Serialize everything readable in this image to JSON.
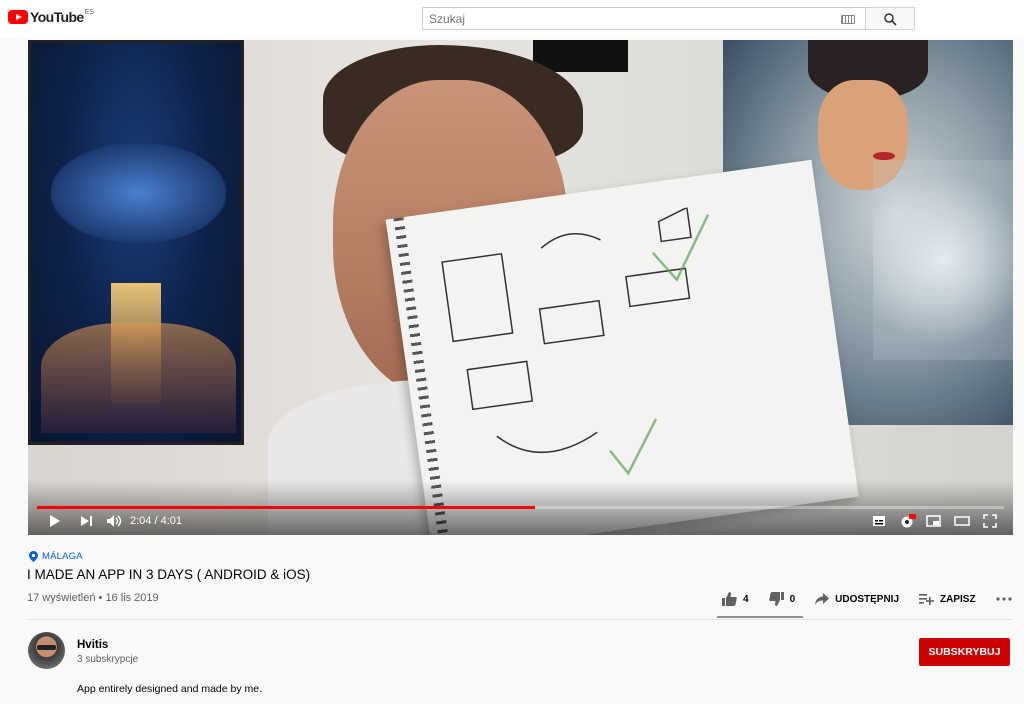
{
  "header": {
    "logo_text": "YouTube",
    "logo_country": "ES",
    "search_placeholder": "Szukaj"
  },
  "player": {
    "current_time": "2:04",
    "duration": "4:01",
    "time_display": "2:04 / 4:01",
    "progress_fraction": 0.515,
    "accent_color": "#ff0000",
    "icons": [
      "play-icon",
      "next-icon",
      "volume-icon",
      "subtitles-icon",
      "settings-icon",
      "miniplayer-icon",
      "theater-icon",
      "fullscreen-icon"
    ]
  },
  "video": {
    "location": "MÁLAGA",
    "title": "I MADE AN APP IN 3 DAYS ( ANDROID & iOS)",
    "meta": "17 wyświetleń • 16 lis 2019",
    "likes": "4",
    "dislikes": "0",
    "share_label": "UDOSTĘPNIJ",
    "save_label": "ZAPISZ"
  },
  "channel": {
    "name": "Hvitis",
    "subscribers": "3 subskrypcje",
    "subscribe_label": "SUBSKRYBUJ",
    "subscribe_color": "#cc0000"
  },
  "description": "App entirely designed and made by me."
}
